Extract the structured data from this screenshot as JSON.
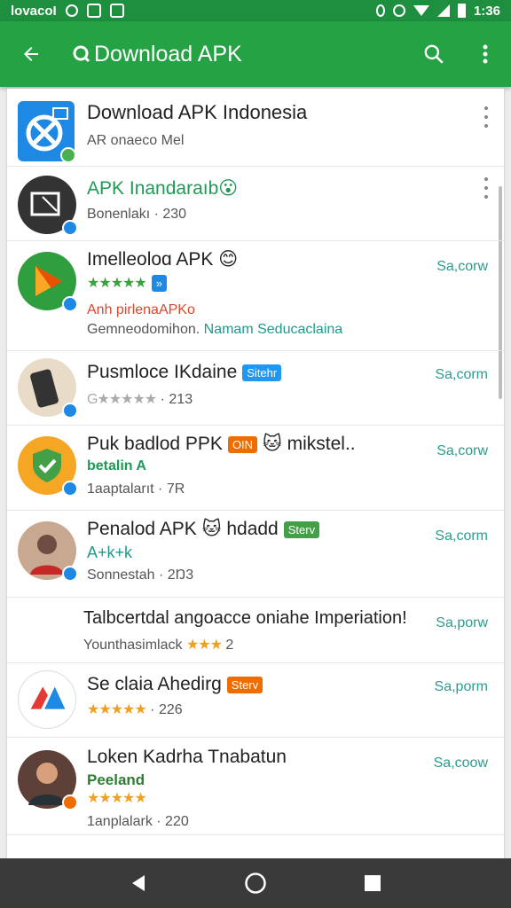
{
  "status_bar": {
    "left_text": "lovacoI",
    "time": "1:36"
  },
  "app_bar": {
    "title": "Download APK",
    "back_icon": "arrow-left-icon",
    "search_icon": "search-icon",
    "more_icon": "more-vert-icon"
  },
  "colors": {
    "app_bar": "#25a244",
    "status_bar": "#1e8f3e",
    "accent": "#2a9d8f",
    "star_green": "#3aa13a",
    "star_gold": "#f0a020"
  },
  "header": {
    "title": "Download APK Indonesia",
    "subtitle": "AR onaeco Mel"
  },
  "items": [
    {
      "title": "APK Inandaraıb",
      "emoji": "😮",
      "sub": "Bonenlakı · 230"
    },
    {
      "title": "Imelleoloɑ APK",
      "emoji": "😊",
      "stars": "★★★★★",
      "tag": "»",
      "line2": "Anh pirlenaAPKo",
      "sub_a": "Gemneodomihon.",
      "sub_b": "Namam Seducaclaina",
      "action": "Sa,corw"
    },
    {
      "title": "Pusmloce IKdaine",
      "tag": "Sitehr",
      "stars_text": "G★★★★★",
      "sub": "· 213",
      "action": "Sa,corm"
    },
    {
      "title": "Puk badlod PPK",
      "tag": "OIN",
      "title_suffix": "🐱 mikstel..",
      "line2": "betalin A",
      "sub": "1aaptalarıt · 7R",
      "action": "Sa,corw"
    },
    {
      "title": "Penalod APK",
      "title_mid": "🐱 hdadd",
      "tag": "Sterv",
      "line2": "A+k+k",
      "sub": "Sonnestah · 2Ŋ3",
      "action": "Sa,corm"
    },
    {
      "title": "Talbcertdal angoacce oniahe Imperiation!",
      "sub": "Younthasimlack",
      "stars": "★★★",
      "num": "2",
      "action": "Sa,porw"
    },
    {
      "title": "Se claia Ahedirg",
      "tag": "Sterv",
      "stars": "★★★★★",
      "sub": "· 226",
      "action": "Sa,porm"
    },
    {
      "title": "Loken Kadrha Tnabatun",
      "line2": "Peeland",
      "stars": "★★★★★",
      "sub": "1anplalark · 220",
      "action": "Sa,coow"
    }
  ],
  "nav": {
    "back": "nav-back-icon",
    "home": "nav-home-icon",
    "recent": "nav-recent-icon"
  }
}
